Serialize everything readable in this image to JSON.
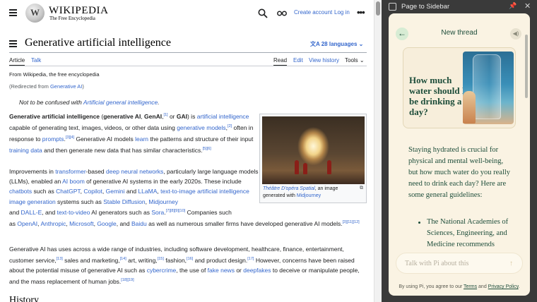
{
  "wiki": {
    "site_title": "WIKIPEDIA",
    "tagline": "The Free Encyclopedia",
    "create_account": "Create account",
    "login": "Log in",
    "page_title": "Generative artificial intelligence",
    "languages": "28 languages",
    "tabs": {
      "article": "Article",
      "talk": "Talk",
      "read": "Read",
      "edit": "Edit",
      "view_history": "View history",
      "tools": "Tools"
    },
    "from": "From Wikipedia, the free encyclopedia",
    "redirected_prefix": "(Redirected from ",
    "redirected_link": "Generative AI",
    "redirected_suffix": ")",
    "hatnote_prefix": "Not to be confused with ",
    "hatnote_link": "Artificial general intelligence",
    "hatnote_suffix": ".",
    "thumb_caption_link": "Théâtre D'opéra Spatial",
    "thumb_caption_mid": ", an image generated with ",
    "thumb_caption_link2": "Midjourney",
    "history_heading": "History",
    "icons": {
      "menu": "hamburger-icon",
      "search": "search-icon",
      "glasses": "glasses-icon",
      "more": "more-icon",
      "toc": "toc-icon",
      "language": "translate-icon",
      "expand": "expand-icon"
    }
  },
  "sidebar": {
    "window_title": "Page to Sidebar",
    "new_thread": "New thread",
    "topic_title": "How much water should I be drinking a day?",
    "message": "Staying hydrated is crucial for physical and mental well-being, but how much water do you really need to drink each day? Here are some general guidelines:",
    "list_item_1": "The National Academies of Sciences, Engineering, and Medicine recommends",
    "input_placeholder": "Talk with Pi about this",
    "footer_prefix": "By using Pi, you agree to our ",
    "footer_terms": "Terms",
    "footer_and": " and ",
    "footer_privacy": "Privacy Policy",
    "footer_suffix": ".",
    "colors": {
      "pi_green": "#1d4d3a",
      "pi_background": "#faf3e3"
    },
    "icons": {
      "back": "back-arrow-icon",
      "sound": "speaker-icon",
      "pin": "pin-icon",
      "close": "close-icon",
      "send": "send-arrow-icon"
    }
  }
}
